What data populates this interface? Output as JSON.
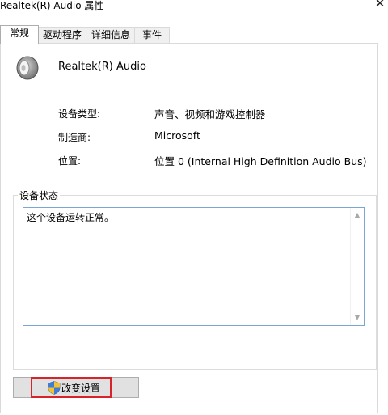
{
  "window": {
    "title": "Realtek(R) Audio 属性",
    "close_glyph": "✕"
  },
  "tabs": [
    {
      "label": "常规",
      "active": true
    },
    {
      "label": "驱动程序",
      "active": false
    },
    {
      "label": "详细信息",
      "active": false
    },
    {
      "label": "事件",
      "active": false
    }
  ],
  "device": {
    "icon": "speaker-icon",
    "name": "Realtek(R) Audio"
  },
  "properties": [
    {
      "label": "设备类型:",
      "value": "声音、视频和游戏控制器"
    },
    {
      "label": "制造商:",
      "value": "Microsoft"
    },
    {
      "label": "位置:",
      "value": "位置 0 (Internal High Definition Audio Bus)"
    }
  ],
  "status": {
    "group_title": "设备状态",
    "text": "这个设备运转正常。"
  },
  "actions": {
    "change_settings_label": "改变设置",
    "change_settings_icon": "uac-shield-icon",
    "highlight_color": "#d9232b"
  }
}
